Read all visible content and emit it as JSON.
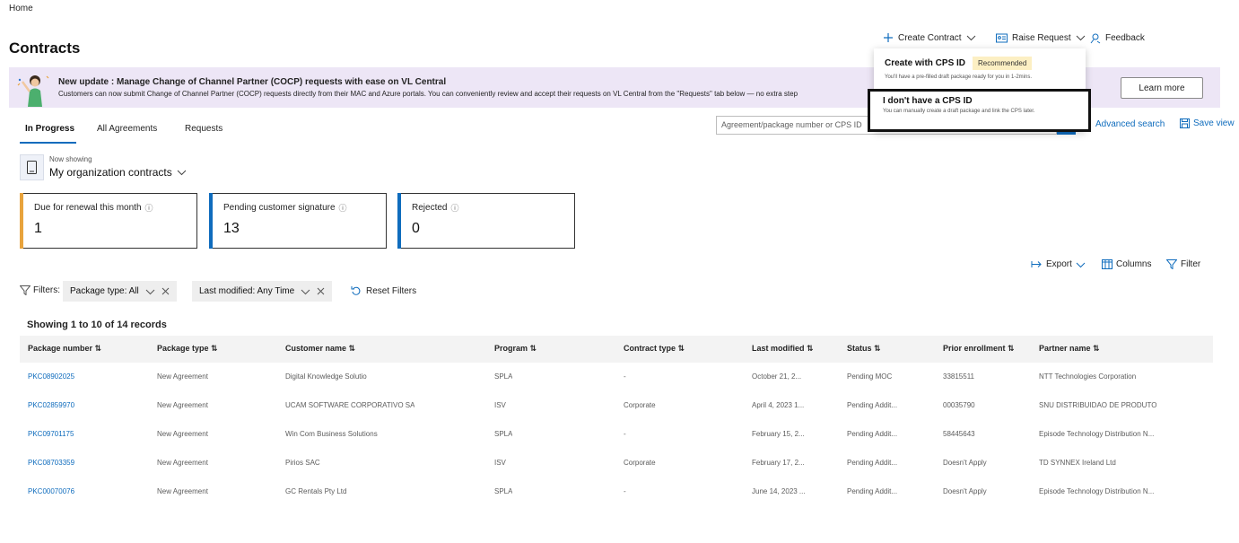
{
  "breadcrumb": "Home",
  "page_title": "Contracts",
  "commands": {
    "create_contract": "Create Contract",
    "raise_request": "Raise Request",
    "feedback": "Feedback"
  },
  "banner": {
    "title": "New update : Manage Change of Channel Partner (COCP) requests with ease on VL Central",
    "text": "Customers can now submit Change of Channel Partner (COCP) requests directly from their MAC and Azure portals. You can conveniently review and accept their requests on VL Central from the \"Requests\" tab below — no extra step",
    "learn_more": "Learn more"
  },
  "create_menu": {
    "option1_title": "Create with CPS ID",
    "option1_badge": "Recommended",
    "option1_desc": "You'll have a pre-filled draft package ready for you in 1-2mins.",
    "option2_title": "I don't have a CPS ID",
    "option2_desc": "You can manually create a draft package and link the CPS later."
  },
  "tabs": [
    "In Progress",
    "All Agreements",
    "Requests"
  ],
  "search": {
    "placeholder": "Agreement/package number or CPS ID"
  },
  "advanced_search": "Advanced search",
  "save_view": "Save view",
  "view_selector": {
    "now_showing": "Now showing",
    "value": "My organization contracts"
  },
  "cards": [
    {
      "label": "Due for renewal this month",
      "value": "1",
      "color": "#e8a33d"
    },
    {
      "label": "Pending customer signature",
      "value": "13",
      "color": "#0f6cbd"
    },
    {
      "label": "Rejected",
      "value": "0",
      "color": "#0f6cbd"
    }
  ],
  "toolbar": {
    "export": "Export",
    "columns": "Columns",
    "filter": "Filter"
  },
  "filters": {
    "label": "Filters:",
    "package_type": "Package type:",
    "package_type_value": "All",
    "last_modified": "Last modified:",
    "last_modified_value": "Any Time",
    "reset": "Reset Filters"
  },
  "records_text": "Showing 1 to 10 of 14 records",
  "table": {
    "headers": [
      "Package number",
      "Package type",
      "Customer name",
      "Program",
      "Contract type",
      "Last modified",
      "Status",
      "Prior enrollment",
      "Partner name"
    ],
    "rows": [
      [
        "PKC08902025",
        "New Agreement",
        "Digital Knowledge Solutio",
        "SPLA",
        "-",
        "October 21, 2...",
        "Pending MOC",
        "33815511",
        "NTT Technologies Corporation"
      ],
      [
        "PKC02859970",
        "New Agreement",
        "UCAM SOFTWARE CORPORATIVO SA",
        "ISV",
        "Corporate",
        "April 4, 2023 1...",
        "Pending Addit...",
        "00035790",
        "SNU DISTRIBUIDAO DE PRODUTO"
      ],
      [
        "PKC09701175",
        "New Agreement",
        "Win Com Business Solutions",
        "SPLA",
        "-",
        "February 15, 2...",
        "Pending Addit...",
        "58445643",
        "Episode Technology Distribution N..."
      ],
      [
        "PKC08703359",
        "New Agreement",
        "Pirios SAC",
        "ISV",
        "Corporate",
        "February 17, 2...",
        "Pending Addit...",
        "Doesn't Apply",
        "TD SYNNEX Ireland Ltd"
      ],
      [
        "PKC00070076",
        "New Agreement",
        "GC Rentals Pty Ltd",
        "SPLA",
        "-",
        "June 14, 2023 ...",
        "Pending Addit...",
        "Doesn't Apply",
        "Episode Technology Distribution N..."
      ]
    ]
  }
}
